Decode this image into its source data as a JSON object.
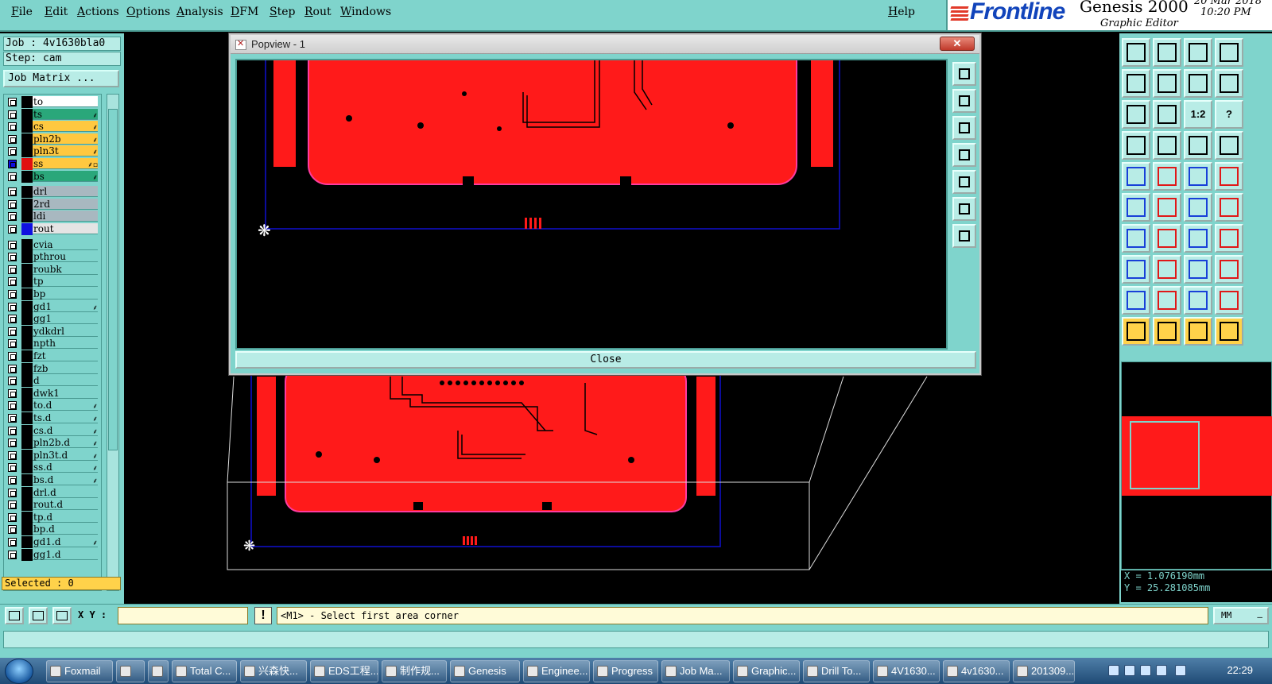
{
  "menubar": {
    "items": [
      "File",
      "Edit",
      "Actions",
      "Options",
      "Analysis",
      "DFM",
      "Step",
      "Rout",
      "Windows"
    ],
    "help": "Help"
  },
  "brand": {
    "logo": "Frontline",
    "product": "Genesis 2000",
    "subtitle": "Graphic Editor",
    "date": "20 Mar 2018",
    "time": "10:20 PM"
  },
  "job": {
    "job_line": "Job : 4v1630bla0",
    "step_line": "Step: cam",
    "matrix_button": "Job Matrix ..."
  },
  "layers": [
    {
      "name": "to",
      "bg": "#ffffff",
      "swatch": "#000000",
      "flag": ""
    },
    {
      "name": "ts",
      "bg": "#2aa77a",
      "swatch": "#000000",
      "flag": "⸙"
    },
    {
      "name": "cs",
      "bg": "#ffc840",
      "swatch": "#000000",
      "flag": "⸙"
    },
    {
      "name": "pln2b",
      "bg": "#ffc840",
      "swatch": "#000000",
      "flag": "⸙"
    },
    {
      "name": "pln3t",
      "bg": "#ffc840",
      "swatch": "#000000",
      "flag": "⸙"
    },
    {
      "name": "ss",
      "bg": "#ffc840",
      "swatch": "#e01010",
      "flag": "⸙▫",
      "active": true
    },
    {
      "name": "bs",
      "bg": "#2aa77a",
      "swatch": "#000000",
      "flag": "⸙"
    },
    {
      "name": "drl",
      "bg": "#a8b8c0",
      "swatch": "#000000",
      "flag": ""
    },
    {
      "name": "2rd",
      "bg": "#a8b8c0",
      "swatch": "#000000",
      "flag": ""
    },
    {
      "name": "ldi",
      "bg": "#a8b8c0",
      "swatch": "#000000",
      "flag": ""
    },
    {
      "name": "rout",
      "bg": "#e4e4e4",
      "swatch": "#1010e0",
      "flag": ""
    },
    {
      "name": "cvia",
      "bg": "#7fd4cc",
      "swatch": "#000000",
      "flag": ""
    },
    {
      "name": "pthrou",
      "bg": "#7fd4cc",
      "swatch": "#000000",
      "flag": ""
    },
    {
      "name": "roubk",
      "bg": "#7fd4cc",
      "swatch": "#000000",
      "flag": ""
    },
    {
      "name": "tp",
      "bg": "#7fd4cc",
      "swatch": "#000000",
      "flag": ""
    },
    {
      "name": "bp",
      "bg": "#7fd4cc",
      "swatch": "#000000",
      "flag": ""
    },
    {
      "name": "gd1",
      "bg": "#7fd4cc",
      "swatch": "#000000",
      "flag": "⸙"
    },
    {
      "name": "gg1",
      "bg": "#7fd4cc",
      "swatch": "#000000",
      "flag": ""
    },
    {
      "name": "ydkdrl",
      "bg": "#7fd4cc",
      "swatch": "#000000",
      "flag": ""
    },
    {
      "name": "npth",
      "bg": "#7fd4cc",
      "swatch": "#000000",
      "flag": ""
    },
    {
      "name": "fzt",
      "bg": "#7fd4cc",
      "swatch": "#000000",
      "flag": ""
    },
    {
      "name": "fzb",
      "bg": "#7fd4cc",
      "swatch": "#000000",
      "flag": ""
    },
    {
      "name": "d",
      "bg": "#7fd4cc",
      "swatch": "#000000",
      "flag": ""
    },
    {
      "name": "dwk1",
      "bg": "#7fd4cc",
      "swatch": "#000000",
      "flag": ""
    },
    {
      "name": "to.d",
      "bg": "#7fd4cc",
      "swatch": "#000000",
      "flag": "⸙"
    },
    {
      "name": "ts.d",
      "bg": "#7fd4cc",
      "swatch": "#000000",
      "flag": "⸙"
    },
    {
      "name": "cs.d",
      "bg": "#7fd4cc",
      "swatch": "#000000",
      "flag": "⸙"
    },
    {
      "name": "pln2b.d",
      "bg": "#7fd4cc",
      "swatch": "#000000",
      "flag": "⸙"
    },
    {
      "name": "pln3t.d",
      "bg": "#7fd4cc",
      "swatch": "#000000",
      "flag": "⸙"
    },
    {
      "name": "ss.d",
      "bg": "#7fd4cc",
      "swatch": "#000000",
      "flag": "⸙"
    },
    {
      "name": "bs.d",
      "bg": "#7fd4cc",
      "swatch": "#000000",
      "flag": "⸙"
    },
    {
      "name": "drl.d",
      "bg": "#7fd4cc",
      "swatch": "#000000",
      "flag": ""
    },
    {
      "name": "rout.d",
      "bg": "#7fd4cc",
      "swatch": "#000000",
      "flag": ""
    },
    {
      "name": "tp.d",
      "bg": "#7fd4cc",
      "swatch": "#000000",
      "flag": ""
    },
    {
      "name": "bp.d",
      "bg": "#7fd4cc",
      "swatch": "#000000",
      "flag": ""
    },
    {
      "name": "gd1.d",
      "bg": "#7fd4cc",
      "swatch": "#000000",
      "flag": "⸙"
    },
    {
      "name": "gg1.d",
      "bg": "#7fd4cc",
      "swatch": "#000000",
      "flag": ""
    }
  ],
  "selected": "Selected : 0",
  "popview": {
    "title": "Popview - 1",
    "close_x": "✕",
    "close_button": "Close"
  },
  "coords": {
    "x": "X = 1.076190mm",
    "y": "Y = 25.281085mm"
  },
  "command": {
    "xy_label": "X Y :",
    "xy_value": "",
    "warn": "!",
    "prompt": "<M1> - Select first area corner",
    "unit": "MM",
    "unit_dash": "—"
  },
  "colors": {
    "panel": "#7fd4cc",
    "copper": "#ff1a1a",
    "outline": "#1010d0",
    "mask_edge": "#ff3aa0"
  },
  "taskbar": {
    "items": [
      "Foxmail",
      "",
      "",
      "Total C...",
      "兴森快...",
      "EDS工程...",
      "制作规...",
      "Genesis",
      "Enginee...",
      "Progress",
      "Job Ma...",
      "Graphic...",
      "Drill To...",
      "4V1630...",
      "4v1630...",
      "201309..."
    ],
    "clock": "22:29"
  }
}
